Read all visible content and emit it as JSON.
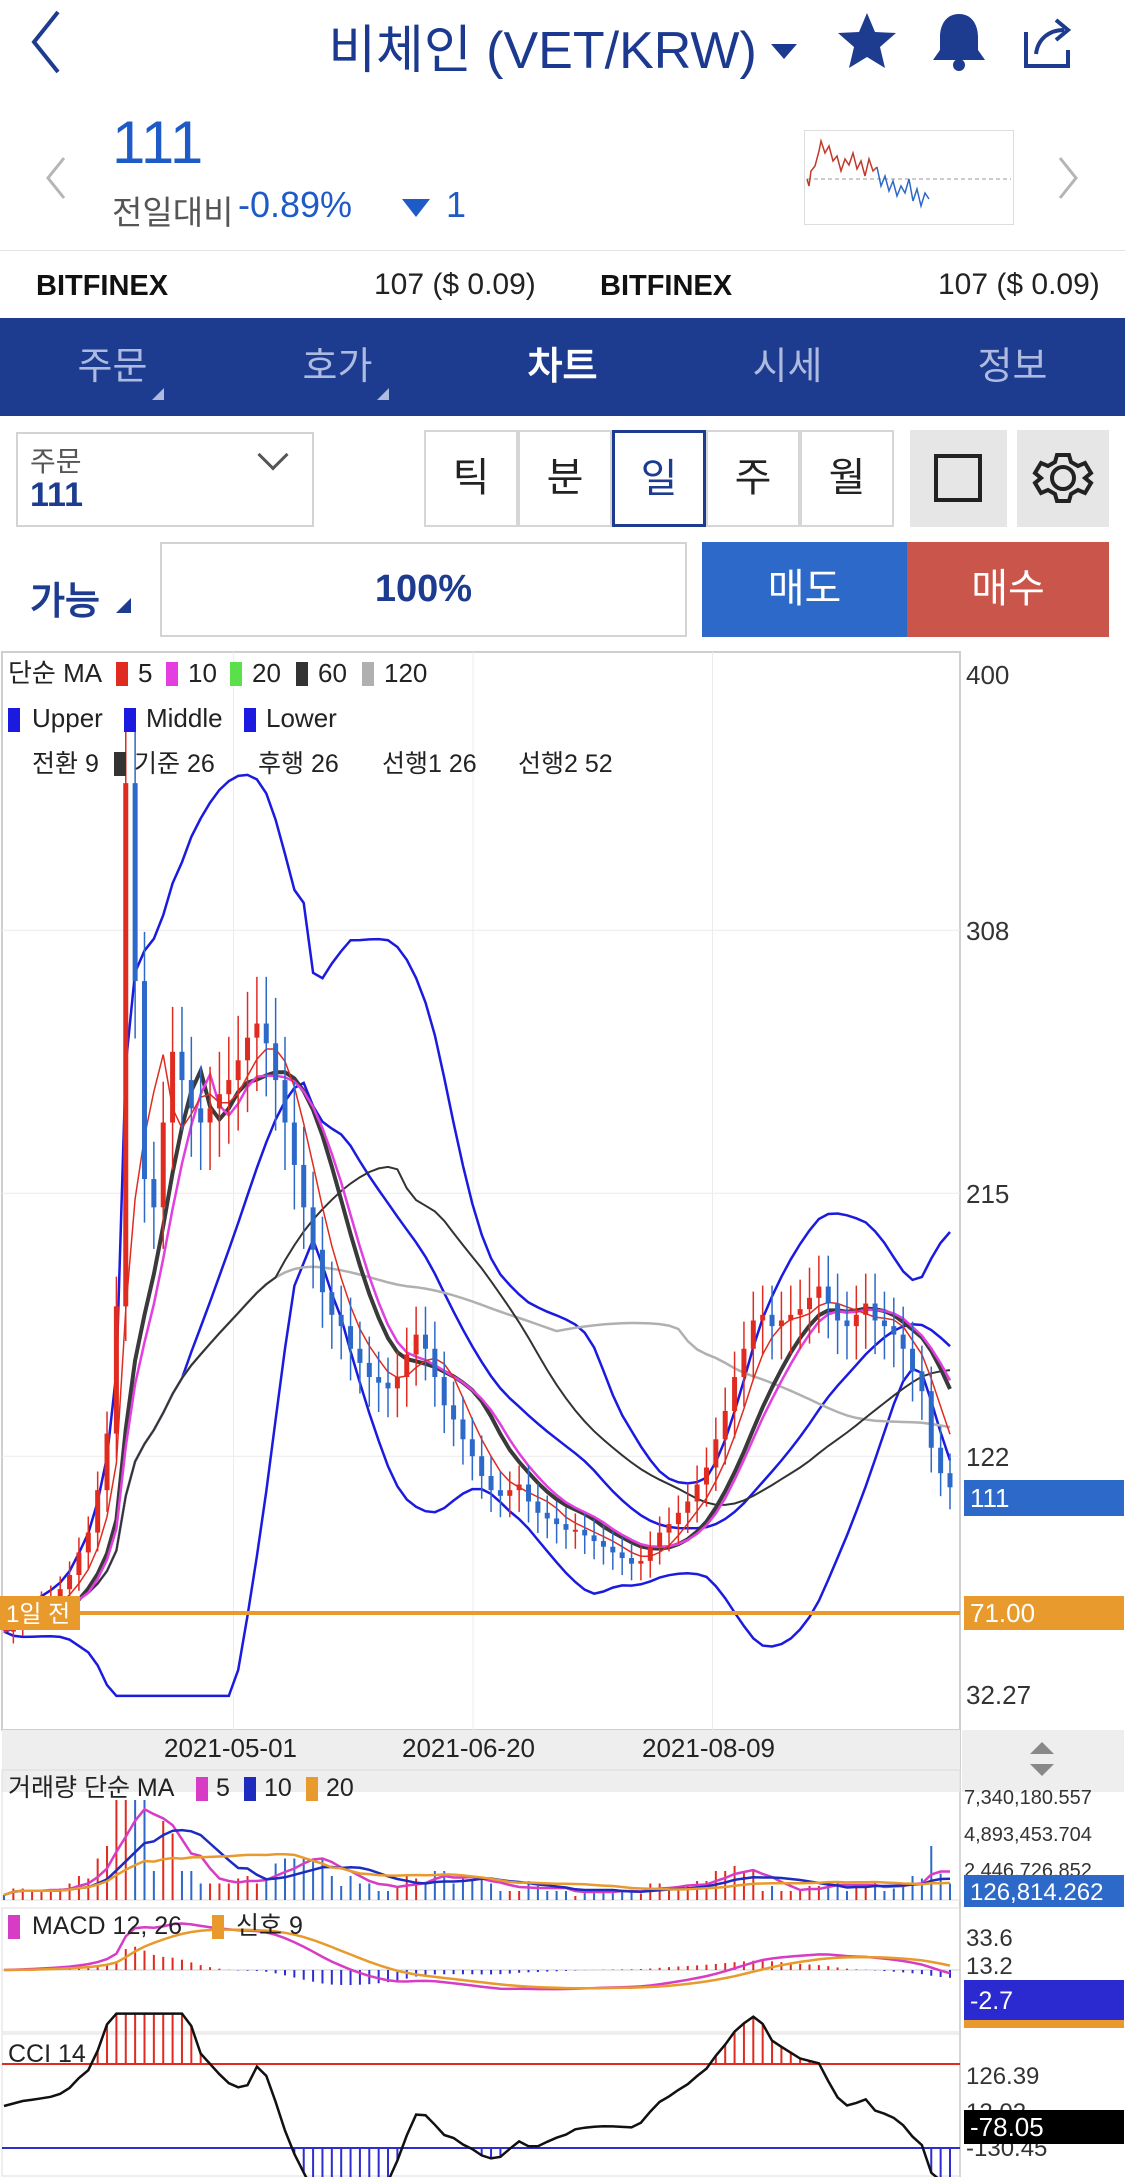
{
  "header": {
    "title": "비체인 (VET/KRW)"
  },
  "quote": {
    "price": "111",
    "change_label": "전일대비",
    "change_pct": "-0.89%",
    "change_value": "1"
  },
  "exchanges": [
    {
      "name": "BITFINEX",
      "value": "107 ($ 0.09)"
    },
    {
      "name": "BITFINEX",
      "value": "107 ($ 0.09)"
    }
  ],
  "tabs": [
    {
      "label": "주문",
      "active": false
    },
    {
      "label": "호가",
      "active": false
    },
    {
      "label": "차트",
      "active": true
    },
    {
      "label": "시세",
      "active": false
    },
    {
      "label": "정보",
      "active": false
    }
  ],
  "order_select": {
    "label": "주문",
    "value": "111"
  },
  "periods": [
    {
      "label": "틱",
      "active": false
    },
    {
      "label": "분",
      "active": false
    },
    {
      "label": "일",
      "active": true
    },
    {
      "label": "주",
      "active": false
    },
    {
      "label": "월",
      "active": false
    }
  ],
  "trade": {
    "available_label": "가능",
    "percent": "100%",
    "sell_label": "매도",
    "buy_label": "매수"
  },
  "colors": {
    "brand_navy": "#1d3b8f",
    "sell": "#2d69c9",
    "buy": "#c9554b",
    "ma5": "#e02b20",
    "ma10": "#e23ee0",
    "ma20": "#59e04a",
    "ma60": "#333333",
    "ma120": "#b0b0b0",
    "bollinger": "#1a1ae0",
    "prev_day_line": "#e89a2c"
  },
  "chart_data": {
    "type": "line",
    "indicator_legends": {
      "ma": {
        "label": "단순 MA",
        "periods": [
          "5",
          "10",
          "20",
          "60",
          "120"
        ]
      },
      "bollinger": [
        "Upper",
        "Middle",
        "Lower"
      ],
      "ichimoku": [
        "전환 9",
        "기준 26",
        "후행 26",
        "선행1 26",
        "선행2 52"
      ]
    },
    "price_axis": {
      "ticks": [
        "400",
        "308",
        "215",
        "122",
        "32.27"
      ],
      "ylim": [
        32.27,
        400
      ]
    },
    "x_ticks": [
      "2021-05-01",
      "2021-06-20",
      "2021-08-09"
    ],
    "current_price": "111",
    "prev_day": {
      "label": "1일 전",
      "value": "71.00"
    },
    "close": [
      60,
      63,
      66,
      68,
      70,
      72,
      75,
      80,
      88,
      95,
      110,
      130,
      175,
      360,
      290,
      220,
      210,
      240,
      265,
      255,
      245,
      240,
      245,
      250,
      255,
      262,
      270,
      275,
      268,
      255,
      240,
      225,
      210,
      195,
      180,
      172,
      168,
      160,
      155,
      150,
      148,
      146,
      150,
      158,
      165,
      160,
      150,
      140,
      135,
      128,
      122,
      115,
      110,
      108,
      110,
      112,
      106,
      102,
      100,
      98,
      96,
      96,
      94,
      92,
      90,
      88,
      86,
      84,
      85,
      90,
      95,
      98,
      102,
      106,
      112,
      118,
      128,
      138,
      150,
      160,
      170,
      172,
      168,
      170,
      172,
      174,
      178,
      182,
      176,
      170,
      168,
      172,
      176,
      170,
      168,
      165,
      160,
      152,
      145,
      125,
      116,
      111
    ],
    "volume_panel": {
      "legend": {
        "label": "거래량 단순 MA",
        "periods": [
          "5",
          "10",
          "20"
        ]
      },
      "ticks": [
        "7,340,180.557",
        "4,893,453.704",
        "2,446,726.852"
      ],
      "current": "126,814.262"
    },
    "macd_panel": {
      "legend": {
        "label": "MACD 12, 26",
        "signal": "신호 9"
      },
      "ticks": [
        "33.6",
        "13.2"
      ],
      "current": "-2.7"
    },
    "cci_panel": {
      "legend": {
        "label": "CCI 14"
      },
      "ticks": [
        "126.39",
        "12.02",
        "-130.45"
      ],
      "current": "-78.05"
    }
  }
}
